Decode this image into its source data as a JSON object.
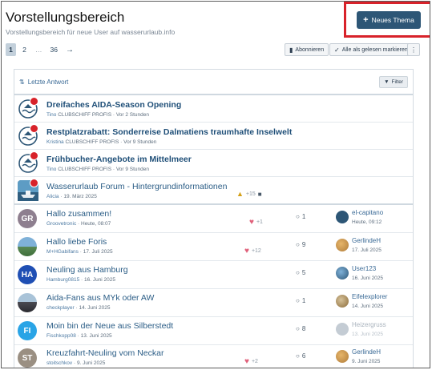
{
  "header": {
    "title": "Vorstellungsbereich",
    "description": "Vorstellungsbereich für neue User auf wasserurlaub.info",
    "new_topic_label": "Neues Thema"
  },
  "pagination": {
    "pages": [
      "1",
      "2",
      "…",
      "36"
    ],
    "current": "1"
  },
  "toolbar": {
    "subscribe_label": "Abonnieren",
    "mark_read_label": "Alle als gelesen markieren"
  },
  "list": {
    "sort_label": "Letzte Antwort",
    "filter_label": "Filter",
    "sticky_topics": [
      {
        "title": "Dreifaches AIDA-Season Opening",
        "author": "Tino",
        "author_title": "CLUBSCHIFF PROFIS",
        "time": "Vor 2 Stunden"
      },
      {
        "title": "Restplatzrabatt: Sonderreise Dalmatiens traumhafte Inselwelt",
        "author": "Kristina",
        "author_title": "CLUBSCHIFF PROFIS",
        "time": "Vor 9 Stunden"
      },
      {
        "title": "Frühbucher-Angebote im Mittelmeer",
        "author": "Tino",
        "author_title": "CLUBSCHIFF PROFIS",
        "time": "Vor 9 Stunden"
      },
      {
        "title": "Wasserurlaub Forum - Hintergrundinformationen",
        "author": "Alicia",
        "time": "19. März 2025",
        "trophy_count": "+15"
      }
    ],
    "topics": [
      {
        "title": "Hallo zusammen!",
        "author": "Groovetronic",
        "time": "Heute, 08:07",
        "initials": "GR",
        "avatar_color": "#8e7f8f",
        "reactions": "+1",
        "replies": "1",
        "last_user": "el-capitano",
        "last_time": "Heute, 09:12"
      },
      {
        "title": "Hallo liebe Foris",
        "author": "M+HGabifans",
        "time": "17. Juli 2025",
        "reactions": "+12",
        "replies": "9",
        "last_user": "GerlindeH",
        "last_time": "17. Juli 2025"
      },
      {
        "title": "Neuling aus Hamburg",
        "author": "Hamburg0815",
        "time": "16. Juni 2025",
        "initials": "HA",
        "avatar_color": "#1f4fb4",
        "replies": "5",
        "last_user": "User123",
        "last_time": "16. Juni 2025"
      },
      {
        "title": "Aida-Fans aus MYk oder AW",
        "author": "checkplayer",
        "time": "14. Juni 2025",
        "replies": "1",
        "last_user": "Eifelexplorer",
        "last_time": "14. Juni 2025"
      },
      {
        "title": "Moin bin der Neue aus Silberstedt",
        "author": "Fischkopp08",
        "time": "13. Juni 2025",
        "initials": "FI",
        "avatar_color": "#2aa4e6",
        "replies": "8",
        "last_user": "Heizergruss",
        "last_time": "13. Juni 2025"
      },
      {
        "title": "Kreuzfahrt-Neuling vom Neckar",
        "author": "stoitschkov",
        "time": "9. Juni 2025",
        "initials": "ST",
        "avatar_color": "#9a8f82",
        "reactions": "+2",
        "replies": "6",
        "last_user": "GerlindeH",
        "last_time": "9. Juni 2025"
      }
    ]
  }
}
